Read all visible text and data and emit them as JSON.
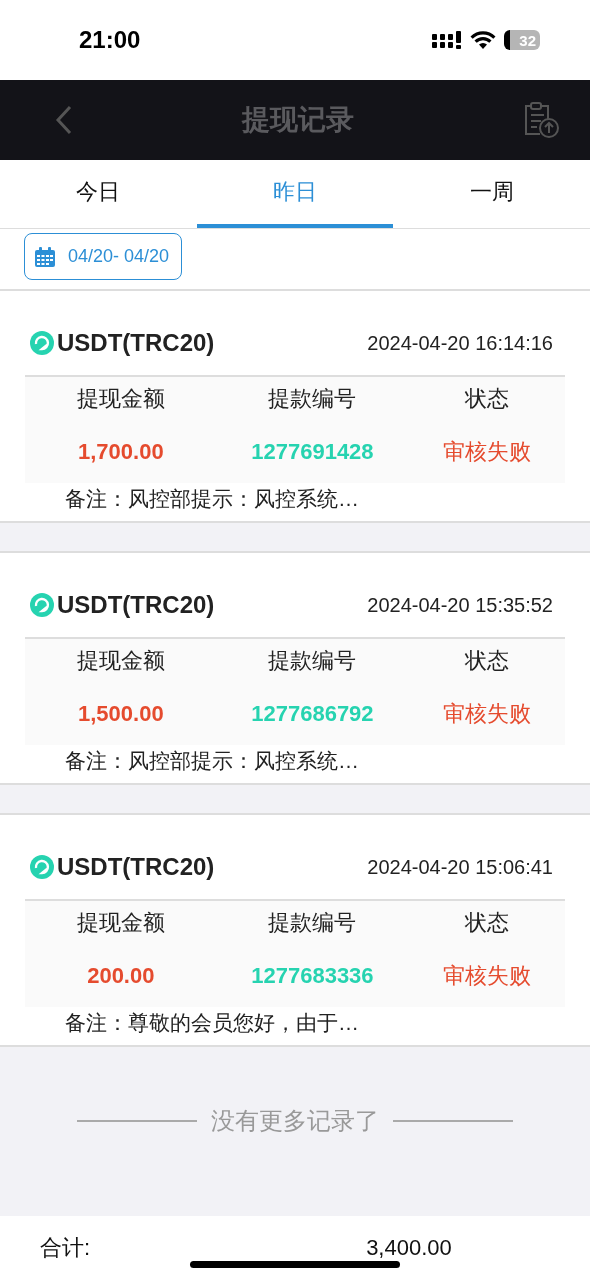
{
  "status_bar": {
    "time": "21:00",
    "battery": "32"
  },
  "header": {
    "title": "提现记录"
  },
  "tabs": [
    {
      "label": "今日",
      "selected": false
    },
    {
      "label": "昨日",
      "selected": true
    },
    {
      "label": "一周",
      "selected": false
    }
  ],
  "date_filter": {
    "label": "04/20- 04/20"
  },
  "records": [
    {
      "currency": "USDT(TRC20)",
      "time": "2024-04-20 16:14:16",
      "columns": [
        "提现金额",
        "提款编号",
        "状态"
      ],
      "amount": "1,700.00",
      "number": "1277691428",
      "status": "审核失败",
      "kind": "failed",
      "note": "备注：风控部提示：风控系统…"
    },
    {
      "currency": "USDT(TRC20)",
      "time": "2024-04-20 15:35:52",
      "columns": [
        "提现金额",
        "提款编号",
        "状态"
      ],
      "amount": "1,500.00",
      "number": "1277686792",
      "status": "审核失败",
      "kind": "failed",
      "note": "备注：风控部提示：风控系统…"
    },
    {
      "currency": "USDT(TRC20)",
      "time": "2024-04-20 15:06:41",
      "columns": [
        "提现金额",
        "提款编号",
        "状态"
      ],
      "amount": "200.00",
      "number": "1277683336",
      "status": "审核失败",
      "kind": "failed",
      "note": "备注：尊敬的会员您好，由于…"
    }
  ],
  "end_text": "没有更多记录了",
  "footer": {
    "total_label": "合计:",
    "total": "3,400.00"
  }
}
